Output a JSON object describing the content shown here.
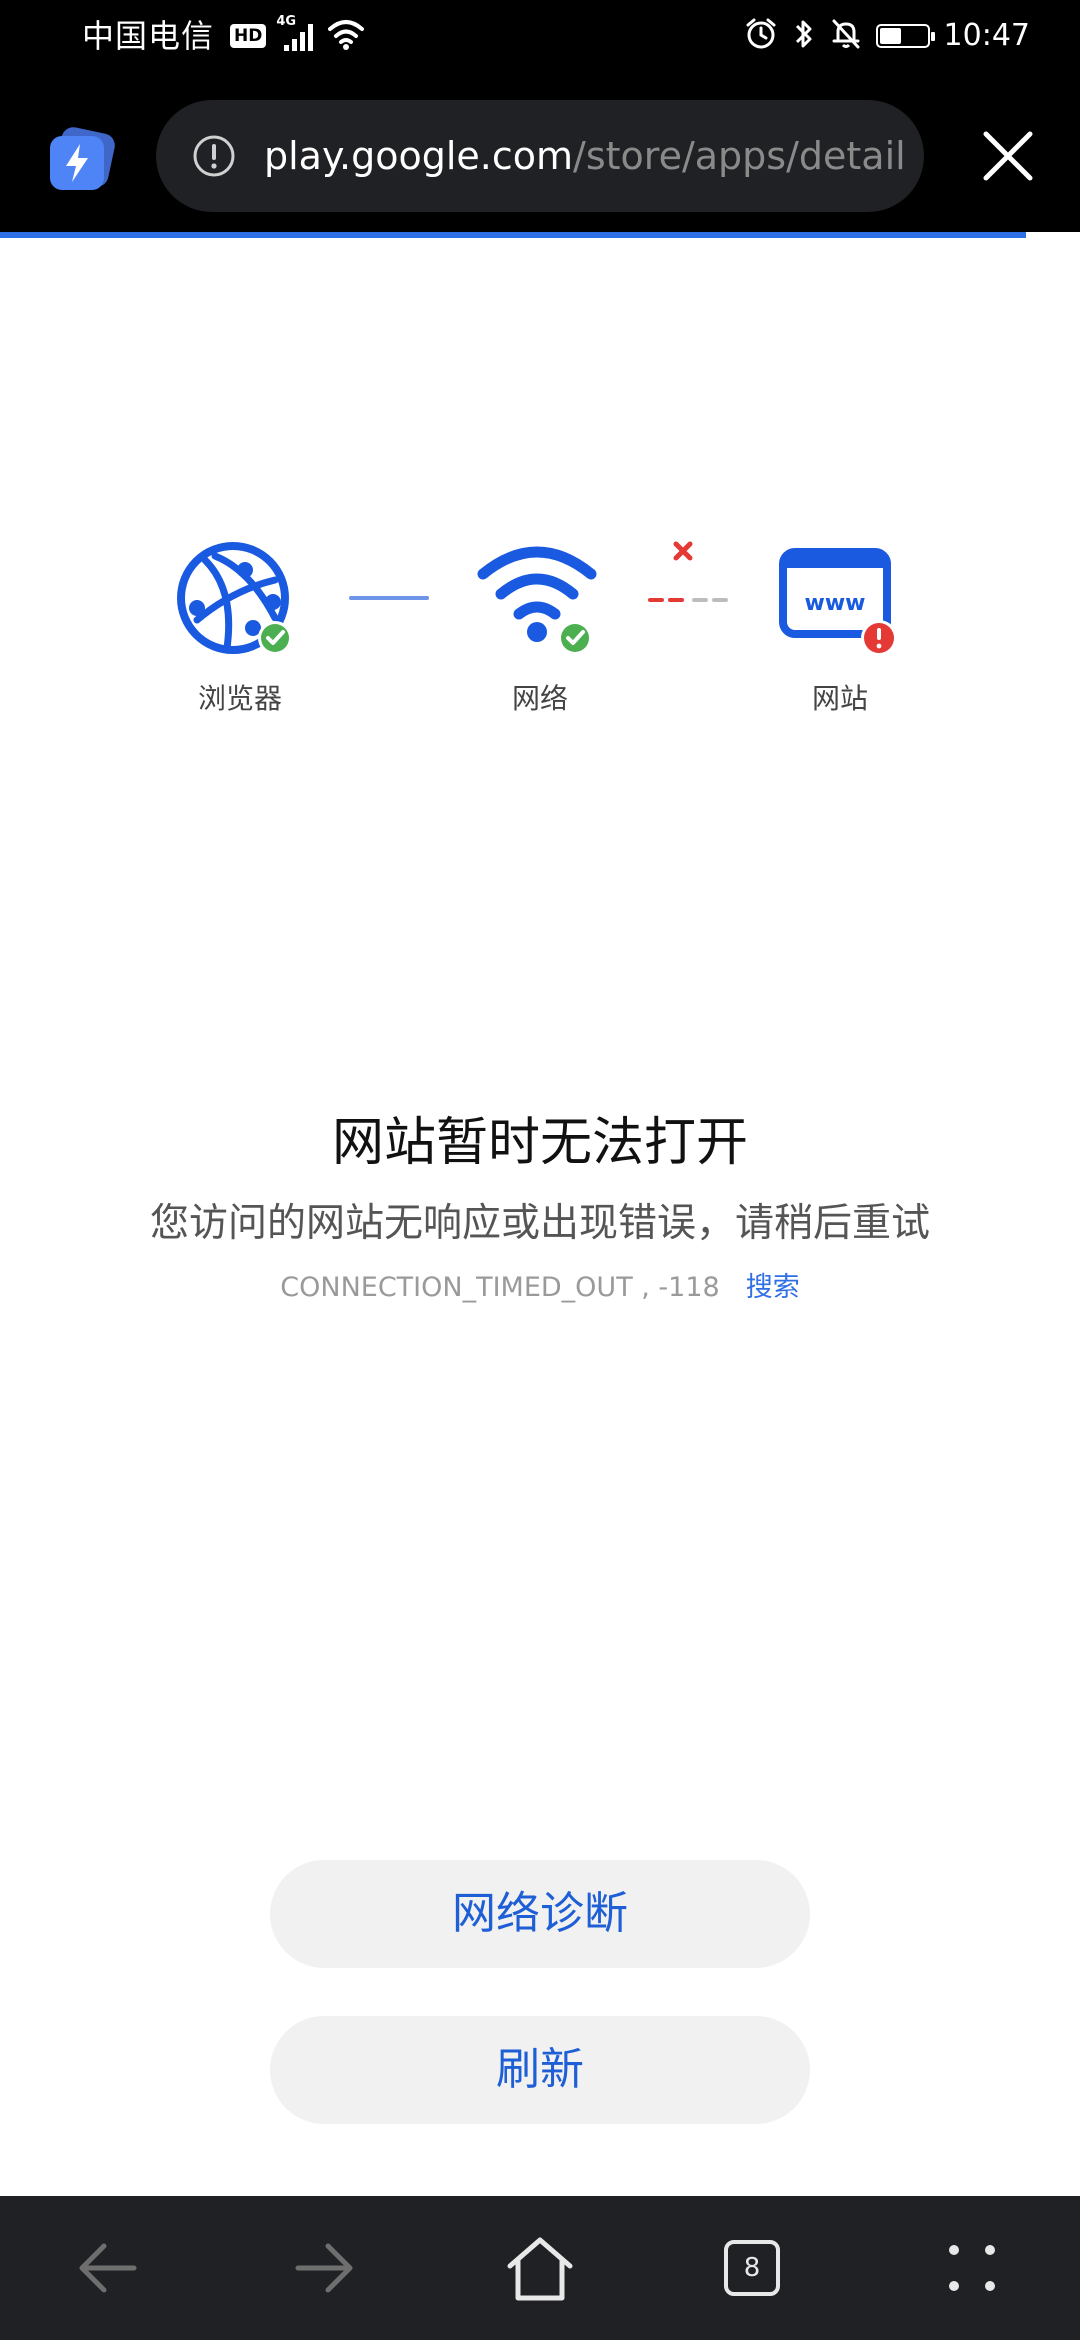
{
  "status_bar": {
    "carrier": "中国电信",
    "hd_badge": "HD",
    "network_type": "4G",
    "time": "10:47",
    "battery_level": 0.45
  },
  "browser": {
    "url_host": "play.google.com",
    "url_path": "/store/apps/details?id=",
    "load_progress": 0.95,
    "accent_color": "#2f6fe4"
  },
  "diagram": {
    "browser_label": "浏览器",
    "network_label": "网络",
    "website_label": "网站",
    "website_icon_text": "www",
    "ok_color": "#4caf50",
    "error_color": "#e53935"
  },
  "message": {
    "title": "网站暂时无法打开",
    "subtitle": "您访问的网站无响应或出现错误，请稍后重试",
    "error_code": "CONNECTION_TIMED_OUT , -118",
    "search_link": "搜索"
  },
  "buttons": {
    "diagnose": "网络诊断",
    "refresh": "刷新"
  },
  "bottom_nav": {
    "tab_count": "8"
  }
}
